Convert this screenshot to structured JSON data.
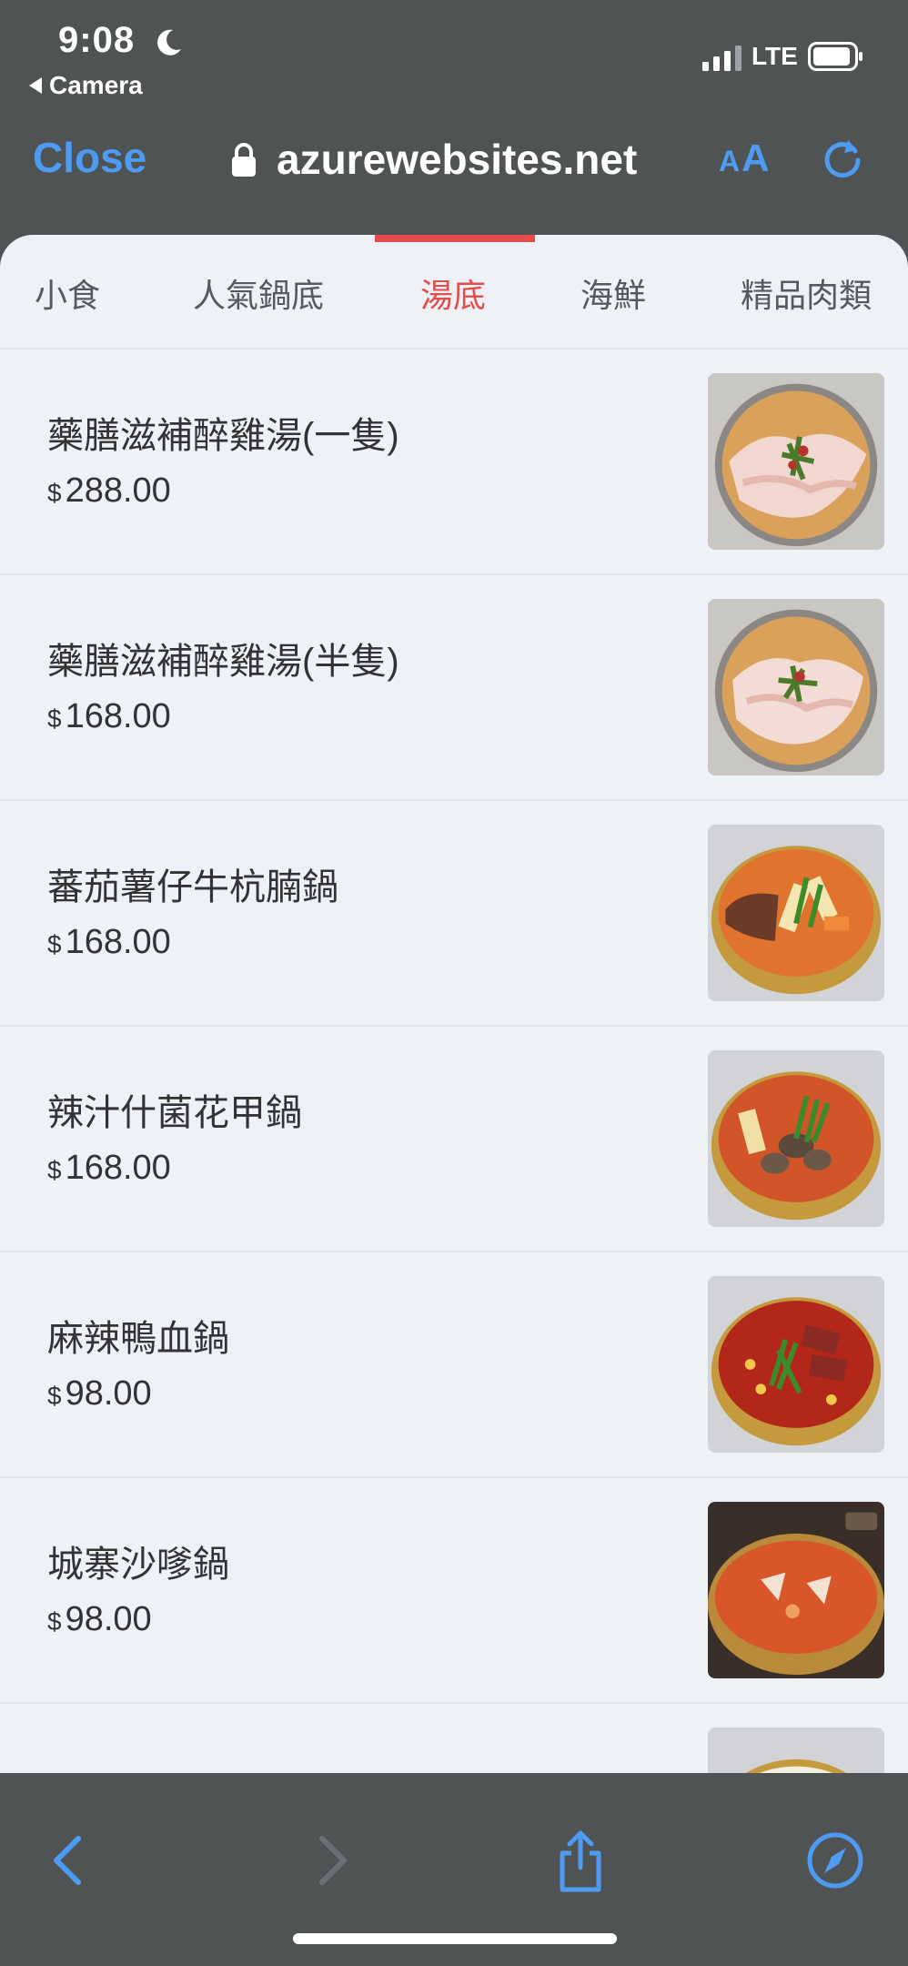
{
  "status_bar": {
    "time": "9:08",
    "back_app": "Camera",
    "network": "LTE"
  },
  "browser": {
    "close_label": "Close",
    "url": "azurewebsites.net",
    "aa_small": "A",
    "aa_large": "A"
  },
  "tabs": [
    {
      "label": "小食",
      "active": false
    },
    {
      "label": "人氣鍋底",
      "active": false
    },
    {
      "label": "湯底",
      "active": true
    },
    {
      "label": "海鮮",
      "active": false
    },
    {
      "label": "精品肉類",
      "active": false
    }
  ],
  "currency_symbol": "$",
  "items": [
    {
      "name": "藥膳滋補醉雞湯(一隻)",
      "price": "288.00"
    },
    {
      "name": "藥膳滋補醉雞湯(半隻)",
      "price": "168.00"
    },
    {
      "name": "蕃茄薯仔牛杭腩鍋",
      "price": "168.00"
    },
    {
      "name": "辣汁什菌花甲鍋",
      "price": "168.00"
    },
    {
      "name": "麻辣鴨血鍋",
      "price": "98.00"
    },
    {
      "name": "城寨沙嗲鍋",
      "price": "98.00"
    }
  ],
  "colors": {
    "accent_blue": "#4d9bf2",
    "active_tab_red": "#e54c4c",
    "chrome_gray": "#505354"
  },
  "icons": {
    "status": [
      "moon-icon",
      "signal-icon",
      "battery-icon"
    ],
    "browser": [
      "lock-icon",
      "reload-icon"
    ],
    "toolbar": [
      "back-arrow-icon",
      "forward-arrow-icon",
      "share-icon",
      "compass-icon"
    ]
  }
}
